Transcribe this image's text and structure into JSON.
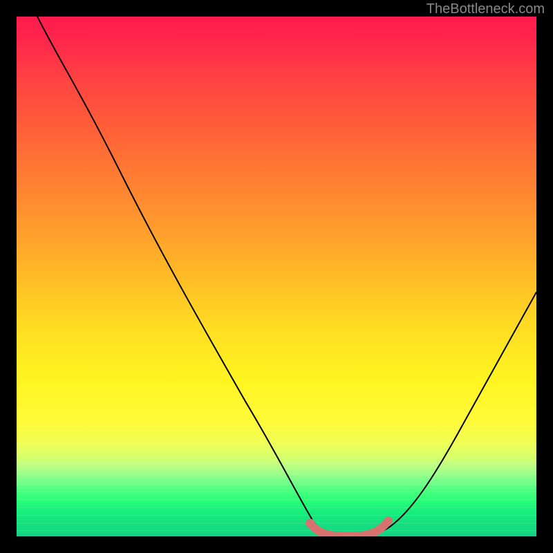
{
  "watermark": "TheBottleneck.com",
  "chart_data": {
    "type": "line",
    "title": "",
    "xlabel": "",
    "ylabel": "",
    "xlim": [
      0,
      100
    ],
    "ylim": [
      0,
      100
    ],
    "series": [
      {
        "name": "curve",
        "x": [
          4,
          10,
          20,
          30,
          40,
          50,
          55,
          58,
          62,
          68,
          72,
          78,
          85,
          92,
          100
        ],
        "y": [
          100,
          88,
          70,
          52,
          35,
          18,
          9,
          3,
          0,
          0,
          1,
          6,
          15,
          28,
          45
        ]
      }
    ],
    "highlight_segment": {
      "x": [
        56.5,
        58,
        62,
        68,
        71.5
      ],
      "y": [
        2.5,
        0.5,
        0,
        0.5,
        3
      ]
    },
    "gradient_stops": [
      {
        "pos": 0,
        "color": "#ff1a4d"
      },
      {
        "pos": 50,
        "color": "#ffbb26"
      },
      {
        "pos": 78,
        "color": "#fffb3a"
      },
      {
        "pos": 100,
        "color": "#13d184"
      }
    ]
  }
}
